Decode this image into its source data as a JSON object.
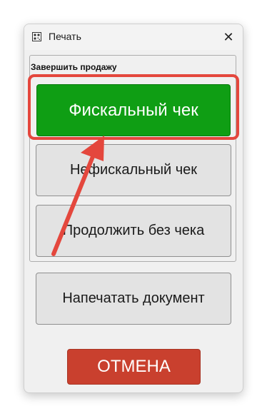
{
  "window": {
    "title": "Печать",
    "close_glyph": "✕"
  },
  "group": {
    "title": "Завершить продажу"
  },
  "buttons": {
    "fiscal": "Фискальный чек",
    "non_fiscal": "Нефискальный чек",
    "continue_no_receipt": "Продолжить без чека",
    "print_document": "Напечатать документ",
    "cancel": "ОТМЕНА"
  },
  "annotation": {
    "highlight_color": "#e4473d",
    "arrow_color": "#e4473d"
  },
  "colors": {
    "fiscal_button": "#0f9e14",
    "cancel_button": "#c9402e"
  }
}
